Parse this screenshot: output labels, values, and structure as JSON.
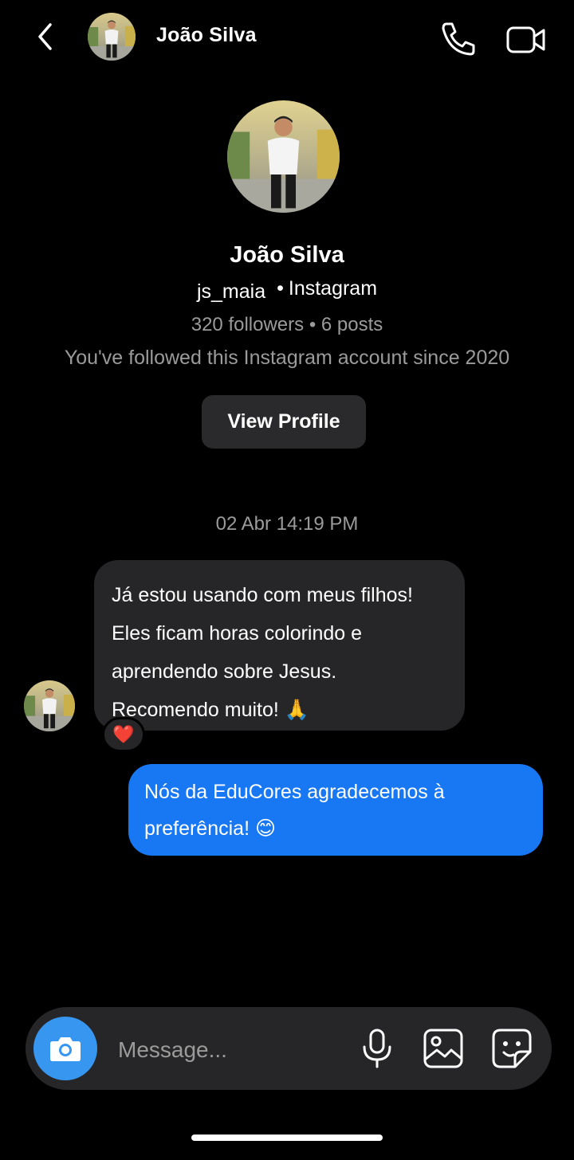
{
  "header": {
    "contact_name": "João Silva",
    "back_icon": "chevron-left-icon",
    "call_icon": "phone-icon",
    "video_icon": "video-camera-icon"
  },
  "profile": {
    "name": "João Silva",
    "username": "js_maia",
    "separator": "•",
    "platform": "Instagram",
    "stats": "320 followers • 6 posts",
    "follow_since": "You've followed this Instagram account since  2020",
    "view_profile_label": "View Profile"
  },
  "conversation": {
    "timestamp": "02 Abr 14:19 PM",
    "incoming": {
      "text": "Já estou usando com meus filhos! Eles ficam horas colorindo e aprendendo sobre Jesus. Recomendo muito! 🙏",
      "reaction": "❤️"
    },
    "outgoing": {
      "text": "Nós da EduCores agradecemos à preferência! 😊"
    }
  },
  "composer": {
    "placeholder": "Message...",
    "camera_icon": "camera-icon",
    "mic_icon": "microphone-icon",
    "gallery_icon": "image-gallery-icon",
    "sticker_icon": "sticker-icon"
  },
  "colors": {
    "background": "#000000",
    "incoming_bubble": "#262628",
    "outgoing_bubble": "#1877f2",
    "camera_button": "#3797f0",
    "secondary_text": "#9b9b9b"
  }
}
